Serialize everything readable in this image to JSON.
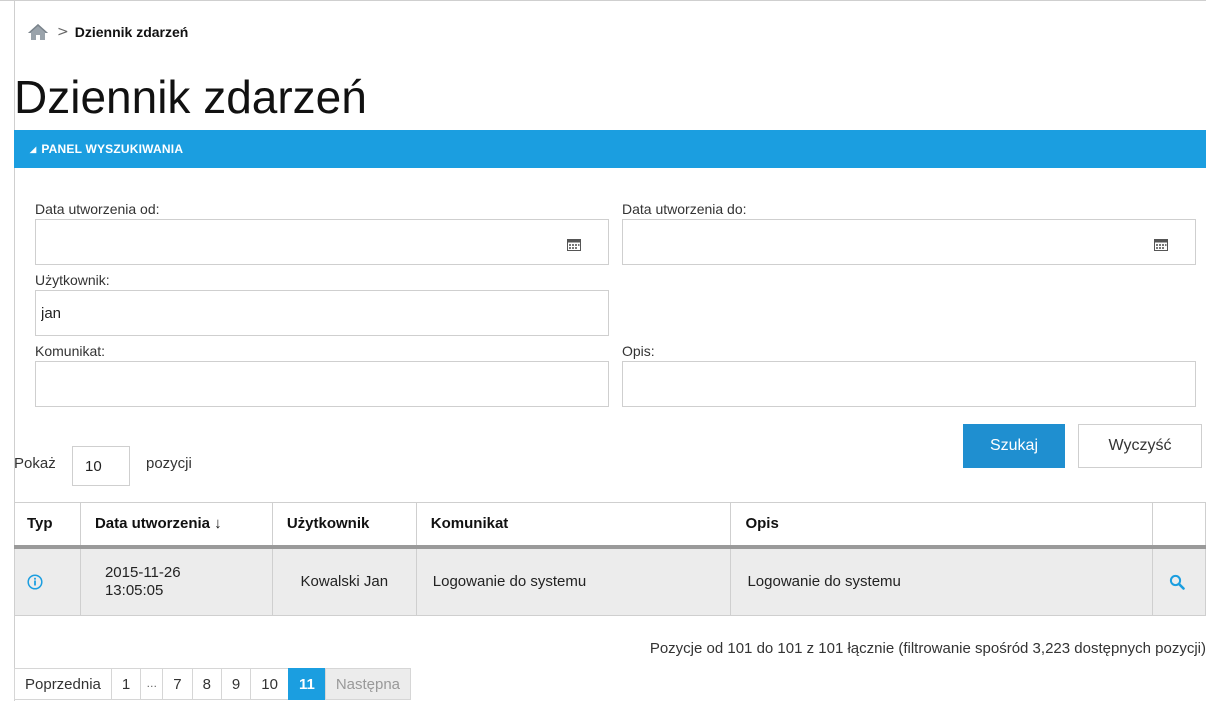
{
  "breadcrumb": {
    "separator": ">",
    "current": "Dziennik zdarzeń"
  },
  "page": {
    "title": "Dziennik zdarzeń"
  },
  "panel": {
    "toggle_icon": "◢",
    "title": "PANEL WYSZUKIWANIA"
  },
  "search": {
    "date_from_label": "Data utworzenia od:",
    "date_from_value": "",
    "date_to_label": "Data utworzenia do:",
    "date_to_value": "",
    "user_label": "Użytkownik:",
    "user_value": "jan",
    "message_label": "Komunikat:",
    "message_value": "",
    "description_label": "Opis:",
    "description_value": "",
    "search_button": "Szukaj",
    "clear_button": "Wyczyść"
  },
  "page_size": {
    "prefix": "Pokaż",
    "value": "10",
    "suffix": "pozycji"
  },
  "table": {
    "headers": {
      "type": "Typ",
      "created": "Data utworzenia ↓",
      "user": "Użytkownik",
      "message": "Komunikat",
      "description": "Opis"
    },
    "rows": [
      {
        "type_icon": "info-icon",
        "date": "2015-11-26",
        "time": "13:05:05",
        "user": "Kowalski Jan",
        "message": "Logowanie do systemu",
        "description": "Logowanie do systemu"
      }
    ]
  },
  "summary": "Pozycje od 101 do 101 z 101 łącznie (filtrowanie spośród 3,223 dostępnych pozycji)",
  "pagination": {
    "prev": "Poprzednia",
    "pages": [
      "1",
      "7",
      "8",
      "9",
      "10",
      "11"
    ],
    "ellipsis": "…",
    "active": "11",
    "next": "Następna"
  },
  "colors": {
    "accent": "#1b9ee0",
    "button_primary": "#1f8fd0",
    "row_background": "#ececec"
  }
}
